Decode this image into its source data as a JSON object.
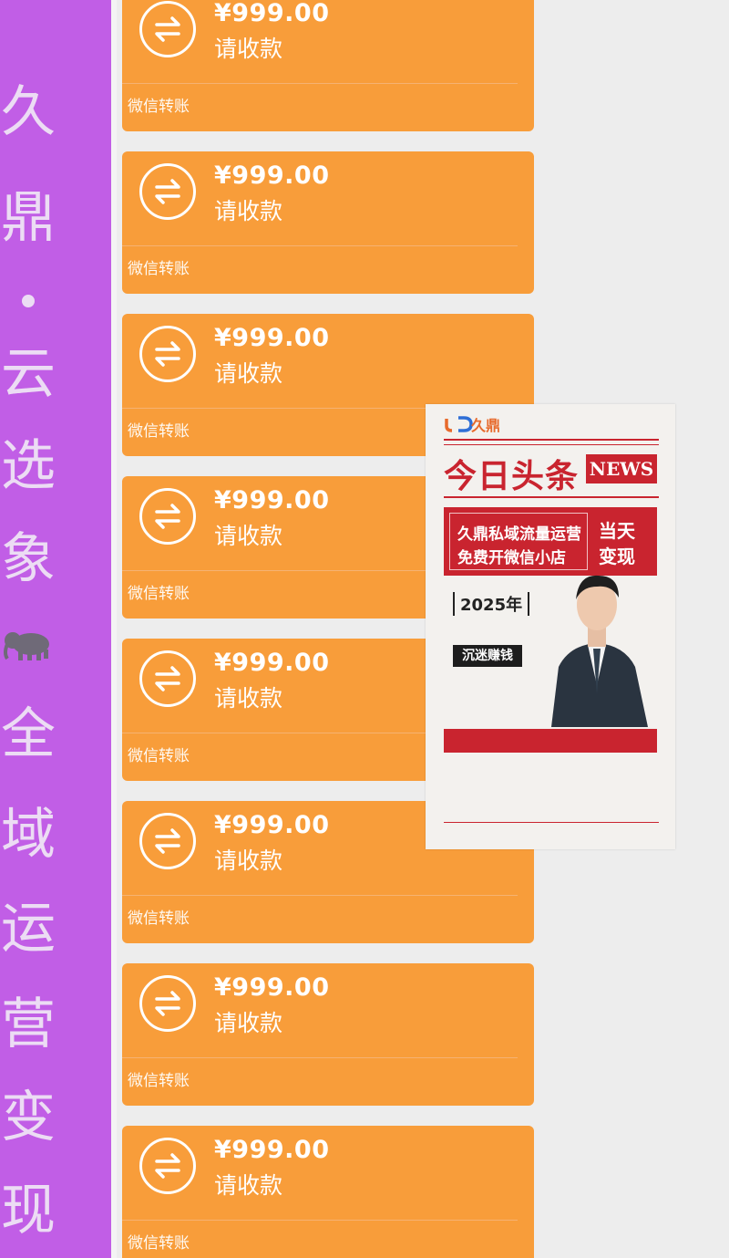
{
  "banner": {
    "chars": [
      "久",
      "鼎",
      "·",
      "云",
      "选",
      "象",
      "全",
      "域",
      "运",
      "营",
      "变",
      "现"
    ],
    "icon": "elephant-icon"
  },
  "cards": [
    {
      "amount": "¥999.00",
      "status": "请收款",
      "footer": "微信转账"
    },
    {
      "amount": "¥999.00",
      "status": "请收款",
      "footer": "微信转账"
    },
    {
      "amount": "¥999.00",
      "status": "请收款",
      "footer": "微信转账"
    },
    {
      "amount": "¥999.00",
      "status": "请收款",
      "footer": "微信转账"
    },
    {
      "amount": "¥999.00",
      "status": "请收款",
      "footer": "微信转账"
    },
    {
      "amount": "¥999.00",
      "status": "请收款",
      "footer": "微信转账"
    },
    {
      "amount": "¥999.00",
      "status": "请收款",
      "footer": "微信转账"
    },
    {
      "amount": "¥999.00",
      "status": "请收款",
      "footer": "微信转账"
    }
  ],
  "card_icon": "transfer-arrows-icon",
  "poster": {
    "logo": "久鼎",
    "headline": "今日头条",
    "news": "NEWS",
    "line1": "久鼎私域流量运营",
    "line2": "免费开微信小店",
    "side1": "当天",
    "side2": "变现",
    "year": "2025年",
    "black_button": "沉迷赚钱"
  },
  "colors": {
    "banner": "#c15ee6",
    "card": "#f89d3a",
    "poster_red": "#c9242f",
    "background": "#ededed"
  }
}
